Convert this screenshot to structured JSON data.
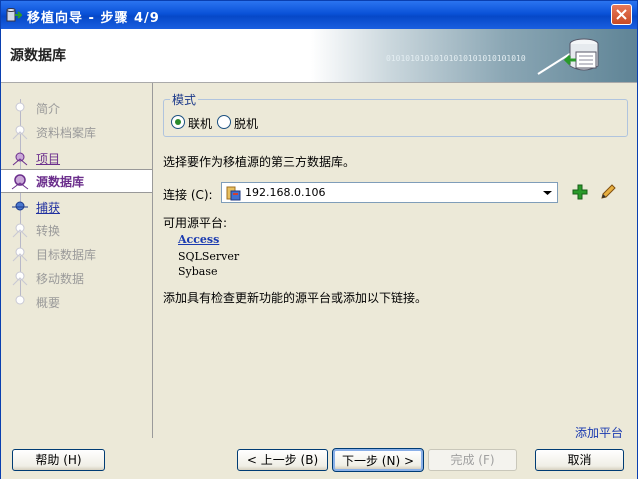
{
  "window": {
    "title": "移植向导 - 步骤 4/9"
  },
  "header": {
    "title": "源数据库",
    "binary": "01010101010101010101010101010"
  },
  "nav": {
    "items": [
      {
        "label": "简介",
        "state": "dim"
      },
      {
        "label": "资料档案库",
        "state": "dim"
      },
      {
        "label": "项目",
        "state": "link"
      },
      {
        "label": "源数据库",
        "state": "current"
      },
      {
        "label": "捕获",
        "state": "linkblue"
      },
      {
        "label": "转换",
        "state": "dim"
      },
      {
        "label": "目标数据库",
        "state": "dim"
      },
      {
        "label": "移动数据",
        "state": "dim"
      },
      {
        "label": "概要",
        "state": "dim"
      }
    ]
  },
  "main": {
    "mode_legend": "模式",
    "mode_options": [
      {
        "label": "联机",
        "selected": true
      },
      {
        "label": "脱机",
        "selected": false
      }
    ],
    "description": "选择要作为移植源的第三方数据库。",
    "connection_label": "连接 (C):",
    "connection_value": "192.168.0.106",
    "available_label": "可用源平台:",
    "platforms": [
      {
        "label": "Access",
        "link": true
      },
      {
        "label": "SQLServer",
        "link": false
      },
      {
        "label": "Sybase",
        "link": false
      }
    ],
    "add_note": "添加具有检查更新功能的源平台或添加以下链接。",
    "add_platform_link": "添加平台"
  },
  "footer": {
    "help": "帮助 (H)",
    "back": "< 上一步 (B)",
    "next": "下一步 (N) >",
    "finish": "完成 (F)",
    "cancel": "取消"
  },
  "colors": {
    "titlebar": "#0a52d8",
    "accent_link": "#1a3ab0",
    "current_step": "#6b2e8c",
    "plus": "#2a9a2a"
  }
}
